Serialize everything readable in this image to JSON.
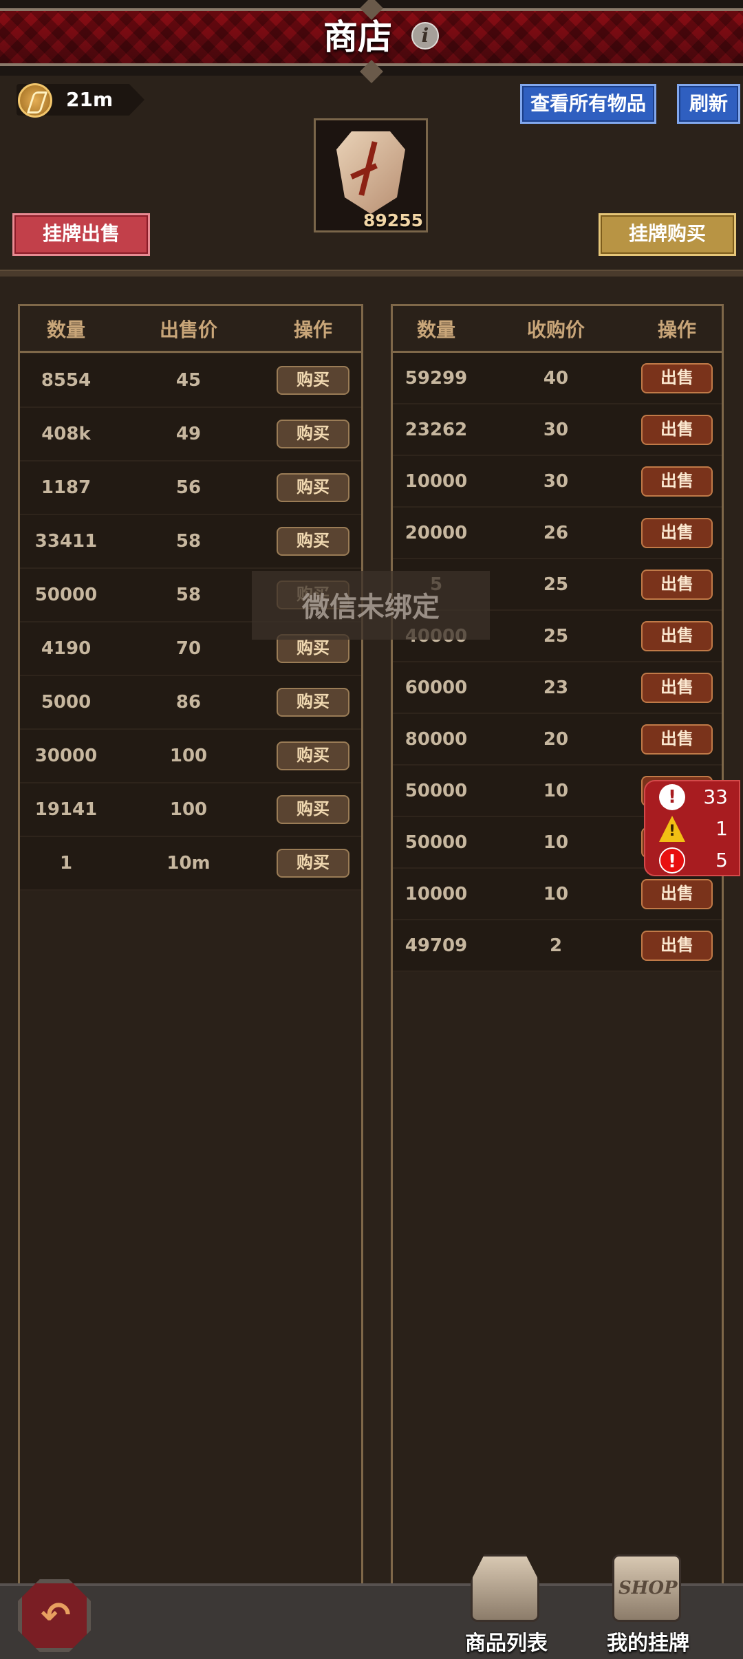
{
  "header": {
    "title": "商店",
    "info_icon": "i"
  },
  "currency": {
    "value": "21m",
    "icon": "coin-icon"
  },
  "buttons": {
    "view_all": "查看所有物品",
    "refresh": "刷新",
    "list_sell": "挂牌出售",
    "list_buy": "挂牌购买"
  },
  "item": {
    "count": "89255",
    "icon": "cracked-stone-icon"
  },
  "sell_table": {
    "headers": [
      "数量",
      "出售价",
      "操作"
    ],
    "action_label": "购买",
    "rows": [
      {
        "qty": "8554",
        "price": "45"
      },
      {
        "qty": "408k",
        "price": "49"
      },
      {
        "qty": "1187",
        "price": "56"
      },
      {
        "qty": "33411",
        "price": "58"
      },
      {
        "qty": "50000",
        "price": "58"
      },
      {
        "qty": "4190",
        "price": "70"
      },
      {
        "qty": "5000",
        "price": "86"
      },
      {
        "qty": "30000",
        "price": "100"
      },
      {
        "qty": "19141",
        "price": "100"
      },
      {
        "qty": "1",
        "price": "10m"
      }
    ]
  },
  "buy_table": {
    "headers": [
      "数量",
      "收购价",
      "操作"
    ],
    "action_label": "出售",
    "rows": [
      {
        "qty": "59299",
        "price": "40"
      },
      {
        "qty": "23262",
        "price": "30"
      },
      {
        "qty": "10000",
        "price": "30"
      },
      {
        "qty": "20000",
        "price": "26"
      },
      {
        "qty": "5",
        "price": "25"
      },
      {
        "qty": "40000",
        "price": "25"
      },
      {
        "qty": "60000",
        "price": "23"
      },
      {
        "qty": "80000",
        "price": "20"
      },
      {
        "qty": "50000",
        "price": "10"
      },
      {
        "qty": "50000",
        "price": "10"
      },
      {
        "qty": "10000",
        "price": "10"
      },
      {
        "qty": "49709",
        "price": "2"
      }
    ]
  },
  "toast": {
    "text": "微信未绑定"
  },
  "alerts": {
    "info_count": "33",
    "warning_count": "1",
    "error_count": "5"
  },
  "nav": {
    "goods_list": "商品列表",
    "my_listings": "我的挂牌",
    "shop_sign": "SHOP"
  },
  "colors": {
    "background": "#2b221a",
    "title_band": "#8a0c14",
    "blue_button": "#2f5fc0",
    "sell_listing_button": "#c2404a",
    "buy_listing_button": "#b89444",
    "sell_action": "#7a331b",
    "buy_action": "#5a4431",
    "alert_panel": "#a81c20"
  }
}
